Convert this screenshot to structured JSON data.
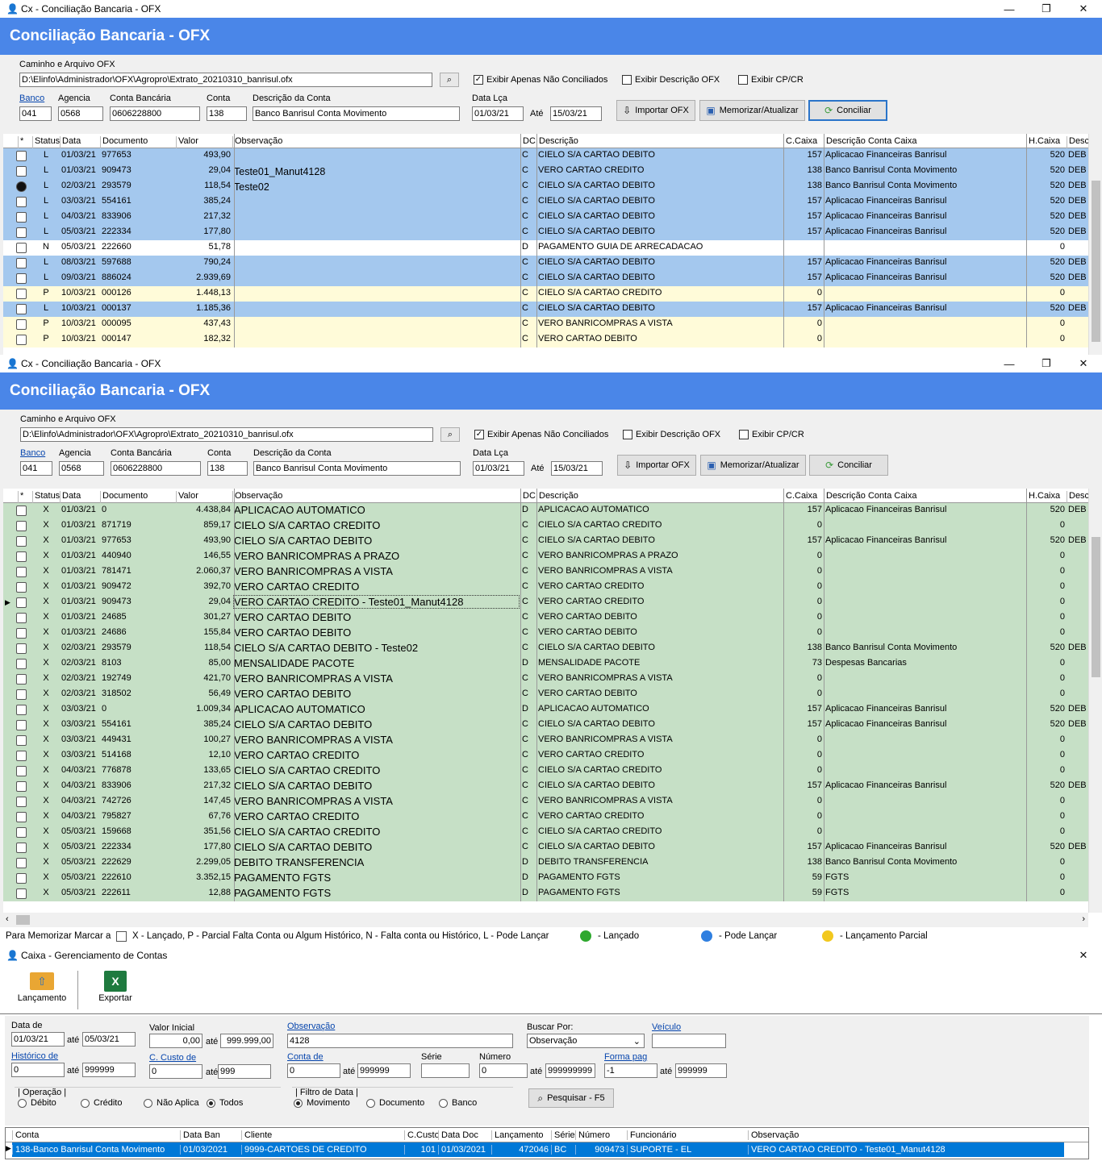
{
  "w1": {
    "title": "Cx - Conciliação Bancaria - OFX",
    "banner": "Conciliação Bancaria - OFX"
  },
  "w2": {
    "title": "Cx - Conciliação Bancaria - OFX",
    "banner": "Conciliação Bancaria - OFX"
  },
  "form": {
    "path_label": "Caminho e Arquivo OFX",
    "path_value": "D:\\Elinfo\\Administrador\\OFX\\Agropro\\Extrato_20210310_banrisul.ofx",
    "chk_nao_conciliados": "Exibir Apenas Não Conciliados",
    "chk_descricao_ofx": "Exibir Descrição OFX",
    "chk_cpcr": "Exibir CP/CR",
    "banco_label": "Banco",
    "banco_value": "041",
    "agencia_label": "Agencia",
    "agencia_value": "0568",
    "conta_bancaria_label": "Conta Bancária",
    "conta_bancaria_value": "0606228800",
    "conta_label": "Conta",
    "conta_value": "138",
    "desc_conta_label": "Descrição da Conta",
    "desc_conta_value": "Banco Banrisul Conta Movimento",
    "data_lca_label": "Data Lça",
    "data_from": "01/03/21",
    "ate_label": "Até",
    "data_to": "15/03/21",
    "btn_importar": "Importar OFX",
    "btn_memorizar": "Memorizar/Atualizar",
    "btn_conciliar": "Conciliar"
  },
  "grid_headers": [
    "*",
    "Status",
    "Data",
    "Documento",
    "Valor",
    "Observação",
    "DC",
    "Descrição",
    "C.Caixa",
    "Descrição Conta Caixa",
    "H.Caixa",
    "Desc"
  ],
  "grid1_rows": [
    {
      "st": "L",
      "data": "01/03/21",
      "doc": "977653",
      "valor": "493,90",
      "obs": "",
      "dc": "C",
      "desc": "CIELO S/A CARTAO DEBITO",
      "cc": "157",
      "dcc": "Aplicacao Financeiras Banrisul",
      "hc": "520",
      "des": "DEB",
      "color": "#a4c8ee"
    },
    {
      "st": "L",
      "data": "01/03/21",
      "doc": "909473",
      "valor": "29,04",
      "obs": "Teste01_Manut4128",
      "dc": "C",
      "desc": "VERO CARTAO CREDITO",
      "cc": "138",
      "dcc": "Banco Banrisul Conta Movimento",
      "hc": "520",
      "des": "DEB",
      "color": "#a4c8ee"
    },
    {
      "st": "L",
      "data": "02/03/21",
      "doc": "293579",
      "valor": "118,54",
      "obs": "Teste02",
      "dc": "C",
      "desc": "CIELO S/A CARTAO DEBITO",
      "cc": "138",
      "dcc": "Banco Banrisul Conta Movimento",
      "hc": "520",
      "des": "DEB",
      "color": "#a4c8ee"
    },
    {
      "st": "L",
      "data": "03/03/21",
      "doc": "554161",
      "valor": "385,24",
      "obs": "",
      "dc": "C",
      "desc": "CIELO S/A CARTAO DEBITO",
      "cc": "157",
      "dcc": "Aplicacao Financeiras Banrisul",
      "hc": "520",
      "des": "DEB",
      "color": "#a4c8ee"
    },
    {
      "st": "L",
      "data": "04/03/21",
      "doc": "833906",
      "valor": "217,32",
      "obs": "",
      "dc": "C",
      "desc": "CIELO S/A CARTAO DEBITO",
      "cc": "157",
      "dcc": "Aplicacao Financeiras Banrisul",
      "hc": "520",
      "des": "DEB",
      "color": "#a4c8ee"
    },
    {
      "st": "L",
      "data": "05/03/21",
      "doc": "222334",
      "valor": "177,80",
      "obs": "",
      "dc": "C",
      "desc": "CIELO S/A CARTAO DEBITO",
      "cc": "157",
      "dcc": "Aplicacao Financeiras Banrisul",
      "hc": "520",
      "des": "DEB",
      "color": "#a4c8ee"
    },
    {
      "st": "N",
      "data": "05/03/21",
      "doc": "222660",
      "valor": "51,78",
      "obs": "",
      "dc": "D",
      "desc": "PAGAMENTO GUIA DE ARRECADACAO",
      "cc": "",
      "dcc": "",
      "hc": "0",
      "des": "",
      "color": "#ffffff"
    },
    {
      "st": "L",
      "data": "08/03/21",
      "doc": "597688",
      "valor": "790,24",
      "obs": "",
      "dc": "C",
      "desc": "CIELO S/A CARTAO DEBITO",
      "cc": "157",
      "dcc": "Aplicacao Financeiras Banrisul",
      "hc": "520",
      "des": "DEB",
      "color": "#a4c8ee"
    },
    {
      "st": "L",
      "data": "09/03/21",
      "doc": "886024",
      "valor": "2.939,69",
      "obs": "",
      "dc": "C",
      "desc": "CIELO S/A CARTAO DEBITO",
      "cc": "157",
      "dcc": "Aplicacao Financeiras Banrisul",
      "hc": "520",
      "des": "DEB",
      "color": "#a4c8ee"
    },
    {
      "st": "P",
      "data": "10/03/21",
      "doc": "000126",
      "valor": "1.448,13",
      "obs": "",
      "dc": "C",
      "desc": "CIELO S/A CARTAO CREDITO",
      "cc": "0",
      "dcc": "",
      "hc": "0",
      "des": "",
      "color": "#fffbd9"
    },
    {
      "st": "L",
      "data": "10/03/21",
      "doc": "000137",
      "valor": "1.185,36",
      "obs": "",
      "dc": "C",
      "desc": "CIELO S/A CARTAO DEBITO",
      "cc": "157",
      "dcc": "Aplicacao Financeiras Banrisul",
      "hc": "520",
      "des": "DEB",
      "color": "#a4c8ee"
    },
    {
      "st": "P",
      "data": "10/03/21",
      "doc": "000095",
      "valor": "437,43",
      "obs": "",
      "dc": "C",
      "desc": "VERO BANRICOMPRAS A VISTA",
      "cc": "0",
      "dcc": "",
      "hc": "0",
      "des": "",
      "color": "#fffbd9"
    },
    {
      "st": "P",
      "data": "10/03/21",
      "doc": "000147",
      "valor": "182,32",
      "obs": "",
      "dc": "C",
      "desc": "VERO CARTAO DEBITO",
      "cc": "0",
      "dcc": "",
      "hc": "0",
      "des": "",
      "color": "#fffbd9"
    }
  ],
  "grid2_rows": [
    {
      "st": "X",
      "data": "01/03/21",
      "doc": "0",
      "valor": "4.438,84",
      "obs": "APLICACAO AUTOMATICO",
      "dc": "D",
      "desc": "APLICACAO AUTOMATICO",
      "cc": "157",
      "dcc": "Aplicacao Financeiras Banrisul",
      "hc": "520",
      "des": "DEB"
    },
    {
      "st": "X",
      "data": "01/03/21",
      "doc": "871719",
      "valor": "859,17",
      "obs": "CIELO S/A CARTAO CREDITO",
      "dc": "C",
      "desc": "CIELO S/A CARTAO CREDITO",
      "cc": "0",
      "dcc": "",
      "hc": "0",
      "des": ""
    },
    {
      "st": "X",
      "data": "01/03/21",
      "doc": "977653",
      "valor": "493,90",
      "obs": "CIELO S/A CARTAO DEBITO",
      "dc": "C",
      "desc": "CIELO S/A CARTAO DEBITO",
      "cc": "157",
      "dcc": "Aplicacao Financeiras Banrisul",
      "hc": "520",
      "des": "DEB"
    },
    {
      "st": "X",
      "data": "01/03/21",
      "doc": "440940",
      "valor": "146,55",
      "obs": "VERO BANRICOMPRAS A PRAZO",
      "dc": "C",
      "desc": "VERO BANRICOMPRAS A PRAZO",
      "cc": "0",
      "dcc": "",
      "hc": "0",
      "des": ""
    },
    {
      "st": "X",
      "data": "01/03/21",
      "doc": "781471",
      "valor": "2.060,37",
      "obs": "VERO BANRICOMPRAS A VISTA",
      "dc": "C",
      "desc": "VERO BANRICOMPRAS A VISTA",
      "cc": "0",
      "dcc": "",
      "hc": "0",
      "des": ""
    },
    {
      "st": "X",
      "data": "01/03/21",
      "doc": "909472",
      "valor": "392,70",
      "obs": "VERO CARTAO CREDITO",
      "dc": "C",
      "desc": "VERO CARTAO CREDITO",
      "cc": "0",
      "dcc": "",
      "hc": "0",
      "des": ""
    },
    {
      "st": "X",
      "data": "01/03/21",
      "doc": "909473",
      "valor": "29,04",
      "obs": "VERO CARTAO CREDITO - Teste01_Manut4128",
      "dc": "C",
      "desc": "VERO CARTAO CREDITO",
      "cc": "0",
      "dcc": "",
      "hc": "0",
      "des": ""
    },
    {
      "st": "X",
      "data": "01/03/21",
      "doc": "24685",
      "valor": "301,27",
      "obs": "VERO CARTAO DEBITO",
      "dc": "C",
      "desc": "VERO CARTAO DEBITO",
      "cc": "0",
      "dcc": "",
      "hc": "0",
      "des": ""
    },
    {
      "st": "X",
      "data": "01/03/21",
      "doc": "24686",
      "valor": "155,84",
      "obs": "VERO CARTAO DEBITO",
      "dc": "C",
      "desc": "VERO CARTAO DEBITO",
      "cc": "0",
      "dcc": "",
      "hc": "0",
      "des": ""
    },
    {
      "st": "X",
      "data": "02/03/21",
      "doc": "293579",
      "valor": "118,54",
      "obs": "CIELO S/A CARTAO DEBITO - Teste02",
      "dc": "C",
      "desc": "CIELO S/A CARTAO DEBITO",
      "cc": "138",
      "dcc": "Banco Banrisul Conta Movimento",
      "hc": "520",
      "des": "DEB"
    },
    {
      "st": "X",
      "data": "02/03/21",
      "doc": "8103",
      "valor": "85,00",
      "obs": "MENSALIDADE PACOTE",
      "dc": "D",
      "desc": "MENSALIDADE PACOTE",
      "cc": "73",
      "dcc": "Despesas Bancarias",
      "hc": "0",
      "des": ""
    },
    {
      "st": "X",
      "data": "02/03/21",
      "doc": "192749",
      "valor": "421,70",
      "obs": "VERO BANRICOMPRAS A VISTA",
      "dc": "C",
      "desc": "VERO BANRICOMPRAS A VISTA",
      "cc": "0",
      "dcc": "",
      "hc": "0",
      "des": ""
    },
    {
      "st": "X",
      "data": "02/03/21",
      "doc": "318502",
      "valor": "56,49",
      "obs": "VERO CARTAO DEBITO",
      "dc": "C",
      "desc": "VERO CARTAO DEBITO",
      "cc": "0",
      "dcc": "",
      "hc": "0",
      "des": ""
    },
    {
      "st": "X",
      "data": "03/03/21",
      "doc": "0",
      "valor": "1.009,34",
      "obs": "APLICACAO AUTOMATICO",
      "dc": "D",
      "desc": "APLICACAO AUTOMATICO",
      "cc": "157",
      "dcc": "Aplicacao Financeiras Banrisul",
      "hc": "520",
      "des": "DEB"
    },
    {
      "st": "X",
      "data": "03/03/21",
      "doc": "554161",
      "valor": "385,24",
      "obs": "CIELO S/A CARTAO DEBITO",
      "dc": "C",
      "desc": "CIELO S/A CARTAO DEBITO",
      "cc": "157",
      "dcc": "Aplicacao Financeiras Banrisul",
      "hc": "520",
      "des": "DEB"
    },
    {
      "st": "X",
      "data": "03/03/21",
      "doc": "449431",
      "valor": "100,27",
      "obs": "VERO BANRICOMPRAS A VISTA",
      "dc": "C",
      "desc": "VERO BANRICOMPRAS A VISTA",
      "cc": "0",
      "dcc": "",
      "hc": "0",
      "des": ""
    },
    {
      "st": "X",
      "data": "03/03/21",
      "doc": "514168",
      "valor": "12,10",
      "obs": "VERO CARTAO CREDITO",
      "dc": "C",
      "desc": "VERO CARTAO CREDITO",
      "cc": "0",
      "dcc": "",
      "hc": "0",
      "des": ""
    },
    {
      "st": "X",
      "data": "04/03/21",
      "doc": "776878",
      "valor": "133,65",
      "obs": "CIELO S/A CARTAO CREDITO",
      "dc": "C",
      "desc": "CIELO S/A CARTAO CREDITO",
      "cc": "0",
      "dcc": "",
      "hc": "0",
      "des": ""
    },
    {
      "st": "X",
      "data": "04/03/21",
      "doc": "833906",
      "valor": "217,32",
      "obs": "CIELO S/A CARTAO DEBITO",
      "dc": "C",
      "desc": "CIELO S/A CARTAO DEBITO",
      "cc": "157",
      "dcc": "Aplicacao Financeiras Banrisul",
      "hc": "520",
      "des": "DEB"
    },
    {
      "st": "X",
      "data": "04/03/21",
      "doc": "742726",
      "valor": "147,45",
      "obs": "VERO BANRICOMPRAS A VISTA",
      "dc": "C",
      "desc": "VERO BANRICOMPRAS A VISTA",
      "cc": "0",
      "dcc": "",
      "hc": "0",
      "des": ""
    },
    {
      "st": "X",
      "data": "04/03/21",
      "doc": "795827",
      "valor": "67,76",
      "obs": "VERO CARTAO CREDITO",
      "dc": "C",
      "desc": "VERO CARTAO CREDITO",
      "cc": "0",
      "dcc": "",
      "hc": "0",
      "des": ""
    },
    {
      "st": "X",
      "data": "05/03/21",
      "doc": "159668",
      "valor": "351,56",
      "obs": "CIELO S/A CARTAO CREDITO",
      "dc": "C",
      "desc": "CIELO S/A CARTAO CREDITO",
      "cc": "0",
      "dcc": "",
      "hc": "0",
      "des": ""
    },
    {
      "st": "X",
      "data": "05/03/21",
      "doc": "222334",
      "valor": "177,80",
      "obs": "CIELO S/A CARTAO DEBITO",
      "dc": "C",
      "desc": "CIELO S/A CARTAO DEBITO",
      "cc": "157",
      "dcc": "Aplicacao Financeiras Banrisul",
      "hc": "520",
      "des": "DEB"
    },
    {
      "st": "X",
      "data": "05/03/21",
      "doc": "222629",
      "valor": "2.299,05",
      "obs": "DEBITO TRANSFERENCIA",
      "dc": "D",
      "desc": "DEBITO TRANSFERENCIA",
      "cc": "138",
      "dcc": "Banco Banrisul Conta Movimento",
      "hc": "0",
      "des": ""
    },
    {
      "st": "X",
      "data": "05/03/21",
      "doc": "222610",
      "valor": "3.352,15",
      "obs": "PAGAMENTO FGTS",
      "dc": "D",
      "desc": "PAGAMENTO FGTS",
      "cc": "59",
      "dcc": "FGTS",
      "hc": "0",
      "des": ""
    },
    {
      "st": "X",
      "data": "05/03/21",
      "doc": "222611",
      "valor": "12,88",
      "obs": "PAGAMENTO FGTS",
      "dc": "D",
      "desc": "PAGAMENTO FGTS",
      "cc": "59",
      "dcc": "FGTS",
      "hc": "0",
      "des": ""
    }
  ],
  "legend": {
    "memorizar": "Para Memorizar Marcar a",
    "codes": "X - Lançado,  P -  Parcial Falta Conta ou Algum Histórico,  N - Falta conta ou Histórico, L - Pode Lançar",
    "lancado": "- Lançado",
    "pode_lancar": "- Pode Lançar",
    "parcial": "- Lançamento Parcial",
    "green": "#2ea82e",
    "blue": "#2f7fe0",
    "yellow": "#f2c81e"
  },
  "w3": {
    "title": "Caixa - Gerenciamento de Contas",
    "tb_lancamento": "Lançamento",
    "tb_exportar": "Exportar",
    "data_de": "Data de",
    "data_from": "01/03/21",
    "ate": "até",
    "data_to": "05/03/21",
    "valor_inicial": "Valor Inicial",
    "valor_from": "0,00",
    "valor_to": "999.999,00",
    "observacao": "Observação",
    "obs_value": "4128",
    "buscar_por": "Buscar Por:",
    "buscar_value": "Observação",
    "veiculo": "Veículo",
    "veiculo_value": "",
    "historico": "Histórico de",
    "hist_from": "0",
    "hist_to": "999999",
    "c_custo": "C. Custo de",
    "cc_from": "0",
    "cc_to": "999",
    "conta_de": "Conta de",
    "conta_from": "0",
    "conta_to": "999999",
    "serie": "Série",
    "serie_value": "",
    "numero": "Número",
    "num_from": "0",
    "num_to": "999999999",
    "forma_pag": "Forma pag",
    "fp_from": "-1",
    "fp_to": "999999",
    "operacao": "Operação",
    "op_debito": "Débito",
    "op_credito": "Crédito",
    "op_nao_aplica": "Não Aplica",
    "op_todos": "Todos",
    "filtro_data": "Filtro de Data",
    "fd_movimento": "Movimento",
    "fd_documento": "Documento",
    "fd_banco": "Banco",
    "btn_pesquisar": "Pesquisar - F5",
    "headers": [
      "Conta",
      "Data Ban",
      "Cliente",
      "C.Custo",
      "Data Doc",
      "Lançamento",
      "Série",
      "Número",
      "Funcionário",
      "Observação"
    ],
    "row": [
      "138-Banco Banrisul Conta Movimento",
      "01/03/2021",
      "9999-CARTOES DE CREDITO",
      "101",
      "01/03/2021",
      "472046",
      "BC",
      "909473",
      "SUPORTE - EL",
      "VERO CARTAO CREDITO - Teste01_Manut4128"
    ],
    "row_color": "#0078d7"
  }
}
